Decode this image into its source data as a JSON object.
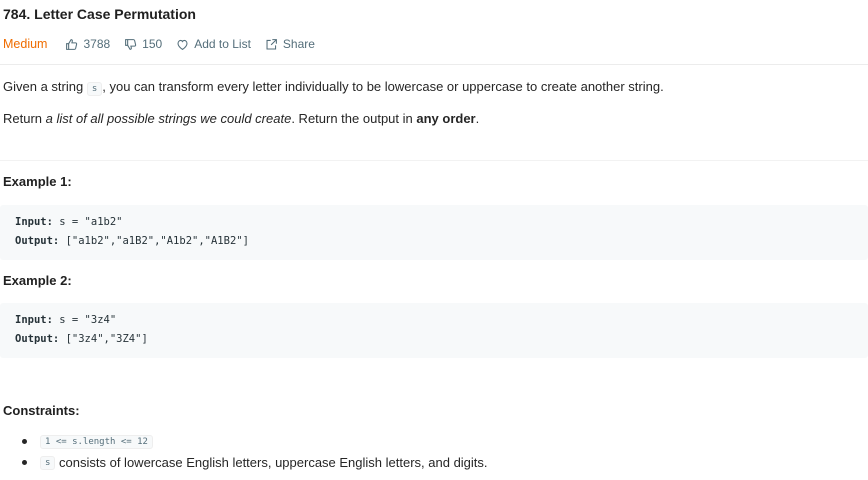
{
  "problem": {
    "title": "784. Letter Case Permutation",
    "difficulty": "Medium",
    "likes": "3788",
    "dislikes": "150",
    "add_to_list": "Add to List",
    "share": "Share"
  },
  "description": {
    "p1_before": "Given a string ",
    "p1_code": "s",
    "p1_after": ", you can transform every letter individually to be lowercase or uppercase to create another string.",
    "p2_before": "Return ",
    "p2_em": "a list of all possible strings we could create",
    "p2_middle": ". Return the output in ",
    "p2_strong": "any order",
    "p2_end": "."
  },
  "examples": [
    {
      "heading": "Example 1:",
      "input_label": "Input:",
      "input_value": " s = \"a1b2\"",
      "output_label": "Output:",
      "output_value": " [\"a1b2\",\"a1B2\",\"A1b2\",\"A1B2\"]"
    },
    {
      "heading": "Example 2:",
      "input_label": "Input:",
      "input_value": " s = \"3z4\"",
      "output_label": "Output:",
      "output_value": " [\"3z4\",\"3Z4\"]"
    }
  ],
  "constraints": {
    "heading": "Constraints:",
    "items": [
      {
        "code": "1 <= s.length <= 12",
        "text": ""
      },
      {
        "code": "s",
        "text": " consists of lowercase English letters, uppercase English letters, and digits."
      }
    ]
  },
  "icons": {
    "like": "thumbs-up-icon",
    "dislike": "thumbs-down-icon",
    "add": "heart-icon",
    "share": "share-icon"
  },
  "colors": {
    "difficulty": "#ef6c00",
    "meta_text": "#546e7a",
    "code_bg": "#f7f9fa"
  }
}
